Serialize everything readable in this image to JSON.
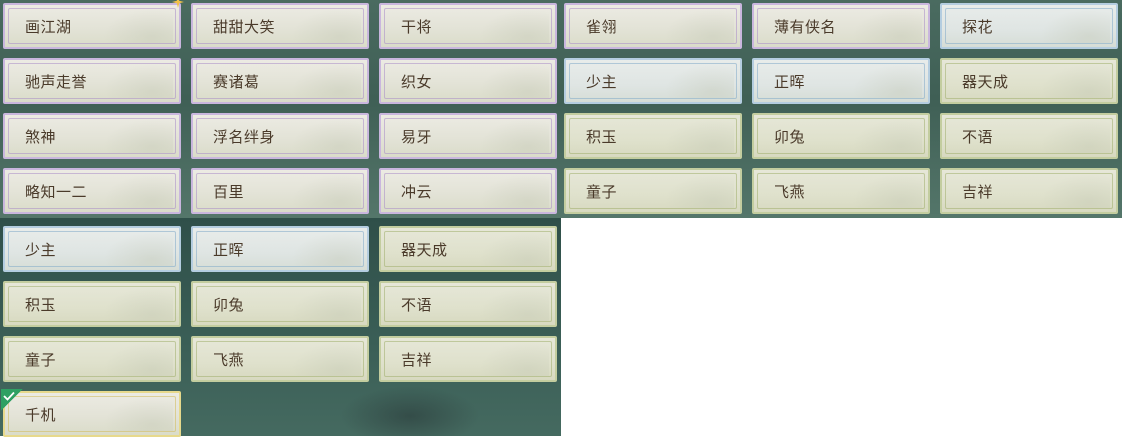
{
  "top_grid": [
    {
      "label": "画江湖",
      "frame": "purple"
    },
    {
      "label": "甜甜大笑",
      "frame": "purple"
    },
    {
      "label": "干将",
      "frame": "purple"
    },
    {
      "label": "雀翎",
      "frame": "purple"
    },
    {
      "label": "薄有侠名",
      "frame": "purple"
    },
    {
      "label": "探花",
      "frame": "blue"
    },
    {
      "label": "驰声走誉",
      "frame": "purple"
    },
    {
      "label": "赛诸葛",
      "frame": "purple"
    },
    {
      "label": "织女",
      "frame": "purple"
    },
    {
      "label": "少主",
      "frame": "blue"
    },
    {
      "label": "正晖",
      "frame": "blue"
    },
    {
      "label": "器天成",
      "frame": "blue"
    },
    {
      "label": "煞神",
      "frame": "purple"
    },
    {
      "label": "浮名绊身",
      "frame": "purple"
    },
    {
      "label": "易牙",
      "frame": "purple"
    },
    {
      "label": "积玉",
      "frame": "green"
    },
    {
      "label": "卯兔",
      "frame": "green"
    },
    {
      "label": "不语",
      "frame": "green"
    },
    {
      "label": "略知一二",
      "frame": "purple"
    },
    {
      "label": "百里",
      "frame": "purple"
    },
    {
      "label": "冲云",
      "frame": "purple"
    },
    {
      "label": "童子",
      "frame": "green"
    },
    {
      "label": "飞燕",
      "frame": "green"
    },
    {
      "label": "吉祥",
      "frame": "green"
    }
  ],
  "bottom_grid": [
    {
      "label": "少主",
      "frame": "blue"
    },
    {
      "label": "正晖",
      "frame": "blue"
    },
    {
      "label": "器天成",
      "frame": "green"
    },
    {
      "label": "积玉",
      "frame": "green"
    },
    {
      "label": "卯兔",
      "frame": "green"
    },
    {
      "label": "不语",
      "frame": "green"
    },
    {
      "label": "童子",
      "frame": "green"
    },
    {
      "label": "飞燕",
      "frame": "green"
    },
    {
      "label": "吉祥",
      "frame": "green"
    },
    {
      "label": "千机",
      "frame": "selected"
    }
  ],
  "colors": {
    "text": "#4a3a2a",
    "selected_check": "#2fa063",
    "purple_frame": "#c9b6de",
    "blue_frame": "#b4cde0",
    "green_frame": "#c3cd9f"
  },
  "icons": {
    "new_marker": "sparkle-icon",
    "selected_marker": "check-icon"
  }
}
